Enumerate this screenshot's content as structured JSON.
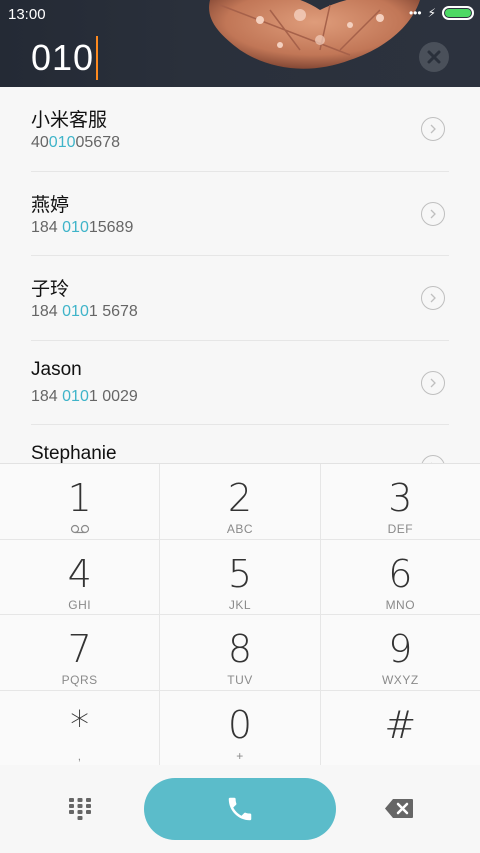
{
  "status_bar": {
    "time": "13:00",
    "signal_icon": "dots-signal-icon",
    "charging_icon": "bolt-icon",
    "battery_icon": "battery-icon",
    "battery_color": "#4cd964"
  },
  "dialer": {
    "input_value": "010",
    "cursor_color": "#ff8a1e",
    "clear_icon": "close-icon"
  },
  "contacts": [
    {
      "name": "小米客服",
      "number_pre": "40",
      "number_match": "010",
      "number_post": "05678"
    },
    {
      "name": "燕婷",
      "number_pre": "184 ",
      "number_match": "010",
      "number_post": "15689"
    },
    {
      "name": "子玲",
      "number_pre": "184 ",
      "number_match": "010",
      "number_post": "1 5678"
    },
    {
      "name": "Jason",
      "number_pre": "184 ",
      "number_match": "010",
      "number_post": "1 0029"
    },
    {
      "name": "Stephanie",
      "number_pre": "",
      "number_match": "",
      "number_post": ""
    }
  ],
  "keypad": {
    "rows": [
      [
        {
          "digit": "1",
          "letters": "",
          "icon": "voicemail-icon"
        },
        {
          "digit": "2",
          "letters": "ABC"
        },
        {
          "digit": "3",
          "letters": "DEF"
        }
      ],
      [
        {
          "digit": "4",
          "letters": "GHI"
        },
        {
          "digit": "5",
          "letters": "JKL"
        },
        {
          "digit": "6",
          "letters": "MNO"
        }
      ],
      [
        {
          "digit": "7",
          "letters": "PQRS"
        },
        {
          "digit": "8",
          "letters": "TUV"
        },
        {
          "digit": "9",
          "letters": "WXYZ"
        }
      ],
      [
        {
          "digit": "*",
          "letters": ","
        },
        {
          "digit": "0",
          "letters": "+"
        },
        {
          "digit": "#",
          "letters": ""
        }
      ]
    ]
  },
  "bottom_bar": {
    "grid_icon": "keypad-grid-icon",
    "call_icon": "phone-icon",
    "backspace_icon": "backspace-icon",
    "call_color": "#5bbcca"
  },
  "colors": {
    "accent": "#3fb4c9",
    "header_bg": "#2a303b"
  }
}
